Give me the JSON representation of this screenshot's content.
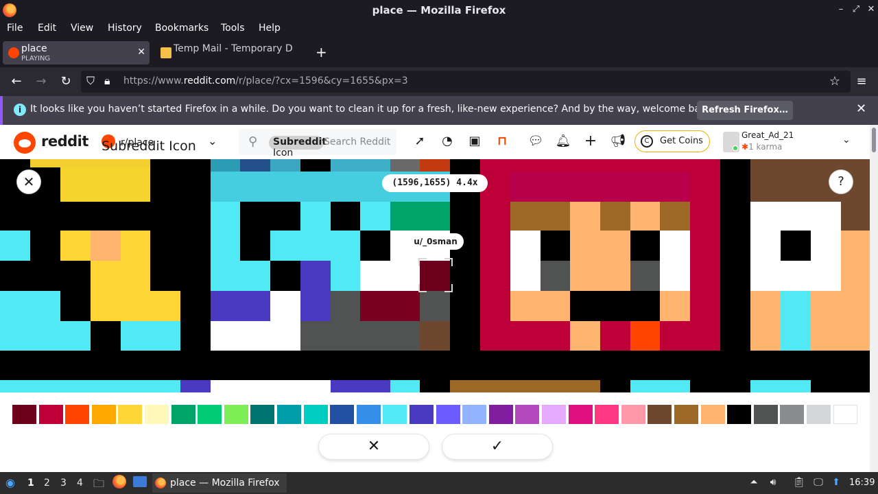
{
  "window": {
    "title": "place — Mozilla Firefox"
  },
  "menu": [
    "File",
    "Edit",
    "View",
    "History",
    "Bookmarks",
    "Tools",
    "Help"
  ],
  "tabs": [
    {
      "title": "place",
      "status": "PLAYING"
    },
    {
      "title": "Temp Mail - Temporary D"
    }
  ],
  "url": {
    "prefix": "https://www.",
    "domain": "reddit.com",
    "path": "/r/place/?cx=1596&cy=1655&px=3"
  },
  "notification": {
    "message": "It looks like you haven’t started Firefox in a while. Do you want to clean it up for a fresh, like-new experience? And by the way, welcome back!",
    "button": "Refresh Firefox…"
  },
  "reddit": {
    "wordmark": "reddit",
    "subreddit": "r/place",
    "subreddit_icon_alt": "Subreddit Icon",
    "search_chip": "Subreddit",
    "search_chip_alt": "Icon",
    "search_placeholder": "Search Reddit",
    "coins_label": "Get Coins",
    "username": "Great_Ad_21",
    "karma": "1 karma"
  },
  "canvas": {
    "coordinates": "(1596,1655) 4.4x",
    "pixel_owner": "u/_0sman"
  },
  "palette_colors": [
    "#6d001a",
    "#be0039",
    "#ff4500",
    "#ffa800",
    "#ffd635",
    "#fff8b8",
    "#00a368",
    "#00cc78",
    "#7eed56",
    "#00756f",
    "#009eaa",
    "#00ccc0",
    "#2450a4",
    "#3690ea",
    "#51e9f4",
    "#493ac1",
    "#6a5cff",
    "#94b3ff",
    "#811e9f",
    "#b44ac0",
    "#e4abff",
    "#de107f",
    "#ff3881",
    "#ff99aa",
    "#6d482f",
    "#9c6926",
    "#ffb470",
    "#000000",
    "#515252",
    "#898d90",
    "#d4d7d9",
    "#ffffff"
  ],
  "taskbar": {
    "workspaces": [
      "1",
      "2",
      "3",
      "4"
    ],
    "app_title": "place — Mozilla Firefox",
    "clock": "16:39"
  }
}
